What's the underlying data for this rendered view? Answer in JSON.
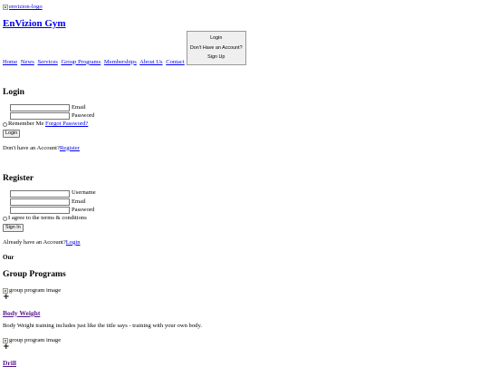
{
  "header": {
    "logo_alt": "envizion-logo",
    "brand": "EnVizion Gym"
  },
  "nav": {
    "links": [
      "Home",
      "News",
      "Services",
      "Group Programs",
      "Memberships",
      "About Us",
      "Contact"
    ]
  },
  "auth_box": {
    "login": "Login",
    "no_account": "Don't Have an Account?",
    "signup": "Sign Up"
  },
  "login": {
    "title": "Login",
    "email_label": "Email",
    "password_label": "Password",
    "remember": "Remember Me",
    "forgot": "Forgot Password?",
    "button": "Login",
    "prompt": "Don't have an Account?",
    "prompt_link": "Register"
  },
  "register": {
    "title": "Register",
    "username_label": "Username",
    "email_label": "Email",
    "password_label": "Password",
    "terms": "I agree to the terms & conditions",
    "button": "Sign In",
    "prompt": "Already have an Account?",
    "prompt_link": "Login"
  },
  "programs": {
    "eyebrow": "Our",
    "title": "Group Programs",
    "image_alt": "group program image",
    "plus": "+",
    "items": [
      {
        "title": "Body Weight",
        "desc": "Body Weight training includes just like the title says - training with your own body."
      },
      {
        "title": "Drill",
        "desc": ""
      }
    ]
  }
}
